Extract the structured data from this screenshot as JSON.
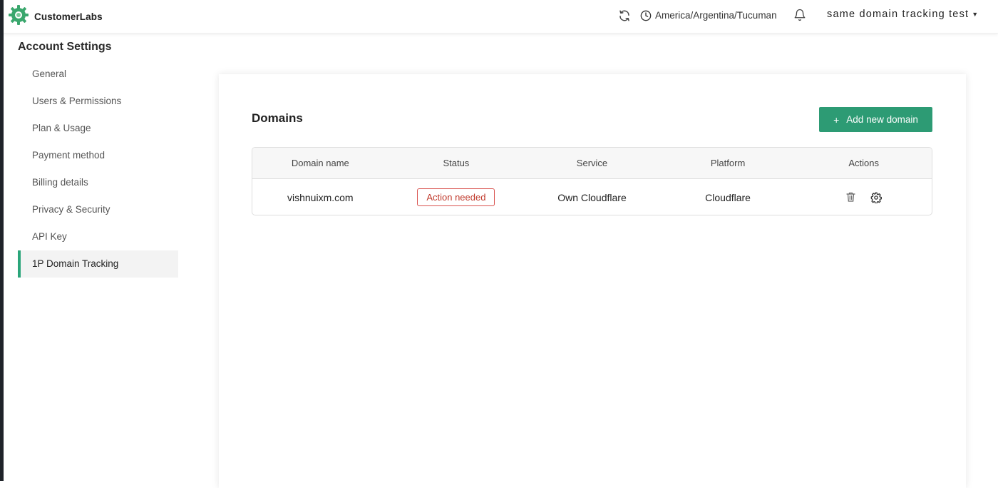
{
  "header": {
    "brand": "CustomerLabs",
    "timezone": "America/Argentina/Tucuman",
    "account_name": "same domain tracking test",
    "icons": {
      "logo": "gear-logo-icon",
      "refresh": "refresh-icon",
      "clock": "clock-icon",
      "bell": "bell-icon",
      "caret": "caret-down-icon"
    }
  },
  "sidebar": {
    "title": "Account Settings",
    "items": [
      {
        "label": "General",
        "active": false
      },
      {
        "label": "Users & Permissions",
        "active": false
      },
      {
        "label": "Plan & Usage",
        "active": false
      },
      {
        "label": "Payment method",
        "active": false
      },
      {
        "label": "Billing details",
        "active": false
      },
      {
        "label": "Privacy & Security",
        "active": false
      },
      {
        "label": "API Key",
        "active": false
      },
      {
        "label": "1P Domain Tracking",
        "active": true
      }
    ]
  },
  "main": {
    "title": "Domains",
    "add_button_label": "Add new domain",
    "table": {
      "columns": [
        "Domain name",
        "Status",
        "Service",
        "Platform",
        "Actions"
      ],
      "rows": [
        {
          "domain": "vishnuixm.com",
          "status": "Action needed",
          "service": "Own Cloudflare",
          "platform": "Cloudflare",
          "actions": [
            "trash-icon",
            "gear-icon"
          ]
        }
      ]
    }
  },
  "colors": {
    "accent": "#2d9b74",
    "active_border": "#2aa57a",
    "status_warning": "#d9534f"
  }
}
